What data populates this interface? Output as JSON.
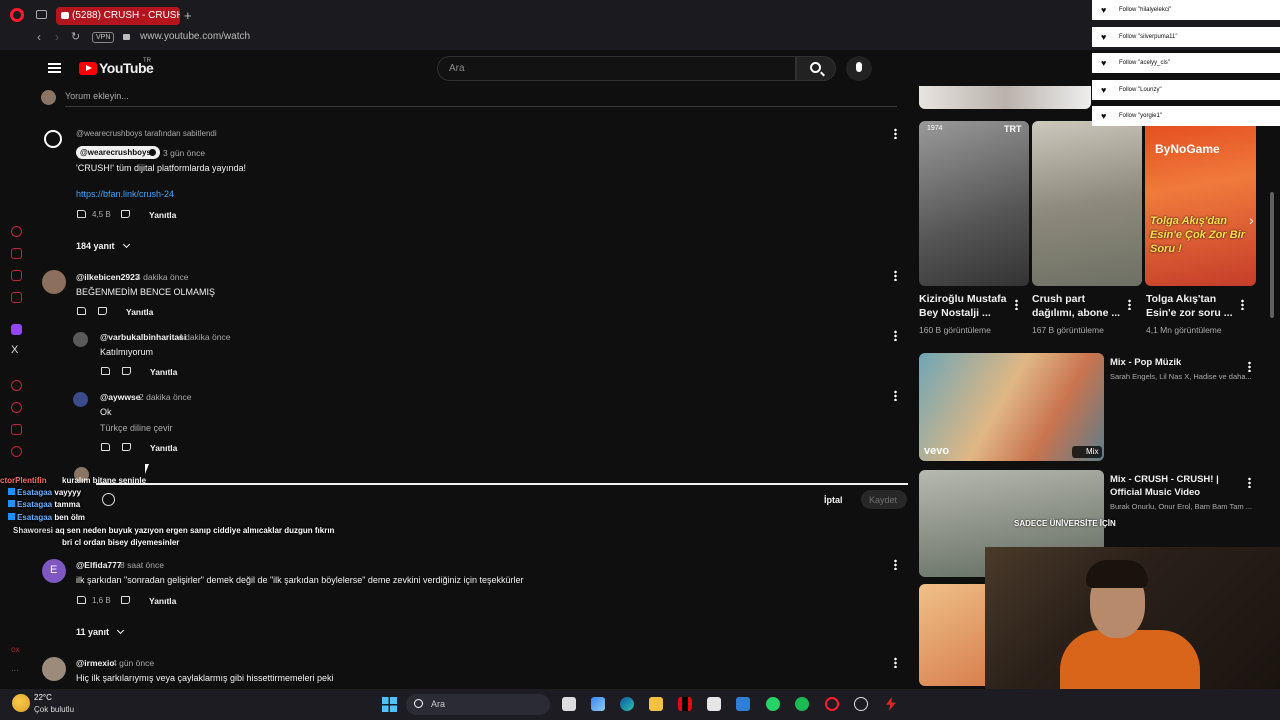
{
  "browser": {
    "tab_title": "(5288) CRUSH - CRUSH! |",
    "url": "www.youtube.com/watch",
    "vpn_label": "VPN",
    "new_tab": "+"
  },
  "youtube": {
    "logo_text": "YouTube",
    "region": "TR",
    "search_placeholder": "Ara"
  },
  "comments": {
    "add_comment_placeholder": "Yorum ekleyin...",
    "reply_label": "Yanıtla",
    "cancel_label": "İptal",
    "save_label": "Kaydet",
    "pinned": {
      "pinned_by": "@wearecrushboys tarafından sabitlendi",
      "author": "@wearecrushboys",
      "time": "3 gün önce",
      "text": "'CRUSH!' tüm dijital platformlarda yayında!",
      "link": "https://bfan.link/crush-24",
      "likes": "4,5 B",
      "replies": "184 yanıt"
    },
    "c1": {
      "author": "@ilkebicen2923",
      "time": "4 dakika önce",
      "text": "BEĞENMEDİM BENCE OLMAMIŞ"
    },
    "r1": {
      "author": "@varbukalbinharitasi",
      "time": "4 dakika önce",
      "text": "Katılmıyorum"
    },
    "r2": {
      "author": "@aywwse",
      "time": "2 dakika önce",
      "text": "Ok",
      "translate": "Türkçe diline çevir"
    },
    "r3_text": "kuralım bitane seninle",
    "c2": {
      "author": "@Elfida777",
      "time": "8 saat önce",
      "text": "ilk şarkıdan \"sonradan gelişirler\" demek değil de \"ilk şarkıdan böylelerse\" deme zevkini verdiğiniz için teşekkürler",
      "likes": "1,6 B",
      "replies": "11 yanıt"
    },
    "c3": {
      "author": "@irmexio",
      "time": "4 gün önce",
      "text": "Hiç ilk şarkılarıymış veya çaylaklarmış gibi hissettirmemeleri peki"
    }
  },
  "chat_overlay": [
    {
      "user": "ctorPlentifin",
      "msg": "kuralım bitane seninle"
    },
    {
      "user": "Esatagaa",
      "msg": "vayyyy"
    },
    {
      "user": "Esatagaa",
      "msg": "tamma"
    },
    {
      "user": "Esatagaa",
      "msg": "ben ölm"
    },
    {
      "user": "Shaworesi",
      "msg": "aq sen neden buyuk yazıyon ergen sanıp ciddiye almıcaklar duzgun fıkrın"
    },
    {
      "user": "",
      "msg": "bri cl ordan bisey diyemesinler"
    }
  ],
  "follows": [
    "Follow \"hilalyelekci\"",
    "Follow \"silverpuma11\"",
    "Follow \"acelyy_cls\"",
    "Follow \"Lounzy\"",
    "Follow \"yorgie1\""
  ],
  "related": {
    "shelf": [
      {
        "title1": "Kiziroğlu Mustafa",
        "title2": "Bey Nostalji ...",
        "views": "160 B görüntüleme",
        "badge": "1974",
        "corner": "TRT"
      },
      {
        "title1": "Crush part",
        "title2": "dağılımı, abone ...",
        "views": "167 B görüntüleme"
      },
      {
        "title1": "Tolga Akış'tan",
        "title2": "Esin'e zor soru ...",
        "views": "4,1 Mn görüntüleme",
        "brand": "ByNoGame",
        "overlay": "Tolga Akış'dan Esin'e Çok Zor Bir Soru !"
      }
    ],
    "mix1": {
      "title": "Mix - Pop Müzik",
      "meta": "Sarah Engels, Lil Nas X, Hadise ve daha...",
      "badge": "Mix",
      "brand": "vevo"
    },
    "mix2": {
      "title1": "Mix - CRUSH - CRUSH! |",
      "title2": "Official Music Video",
      "meta": "Burak Onurlu, Onur Erol, Bam Bam Tam ...",
      "overlay": "SADECE ÜNİVERSİTE İÇİN"
    }
  },
  "taskbar": {
    "temp": "22°C",
    "weather": "Çok bulutlu",
    "search": "Ara"
  },
  "colors": {
    "accent": "#ff0000",
    "opera": "#ff1b2d",
    "link": "#3ea6ff"
  }
}
